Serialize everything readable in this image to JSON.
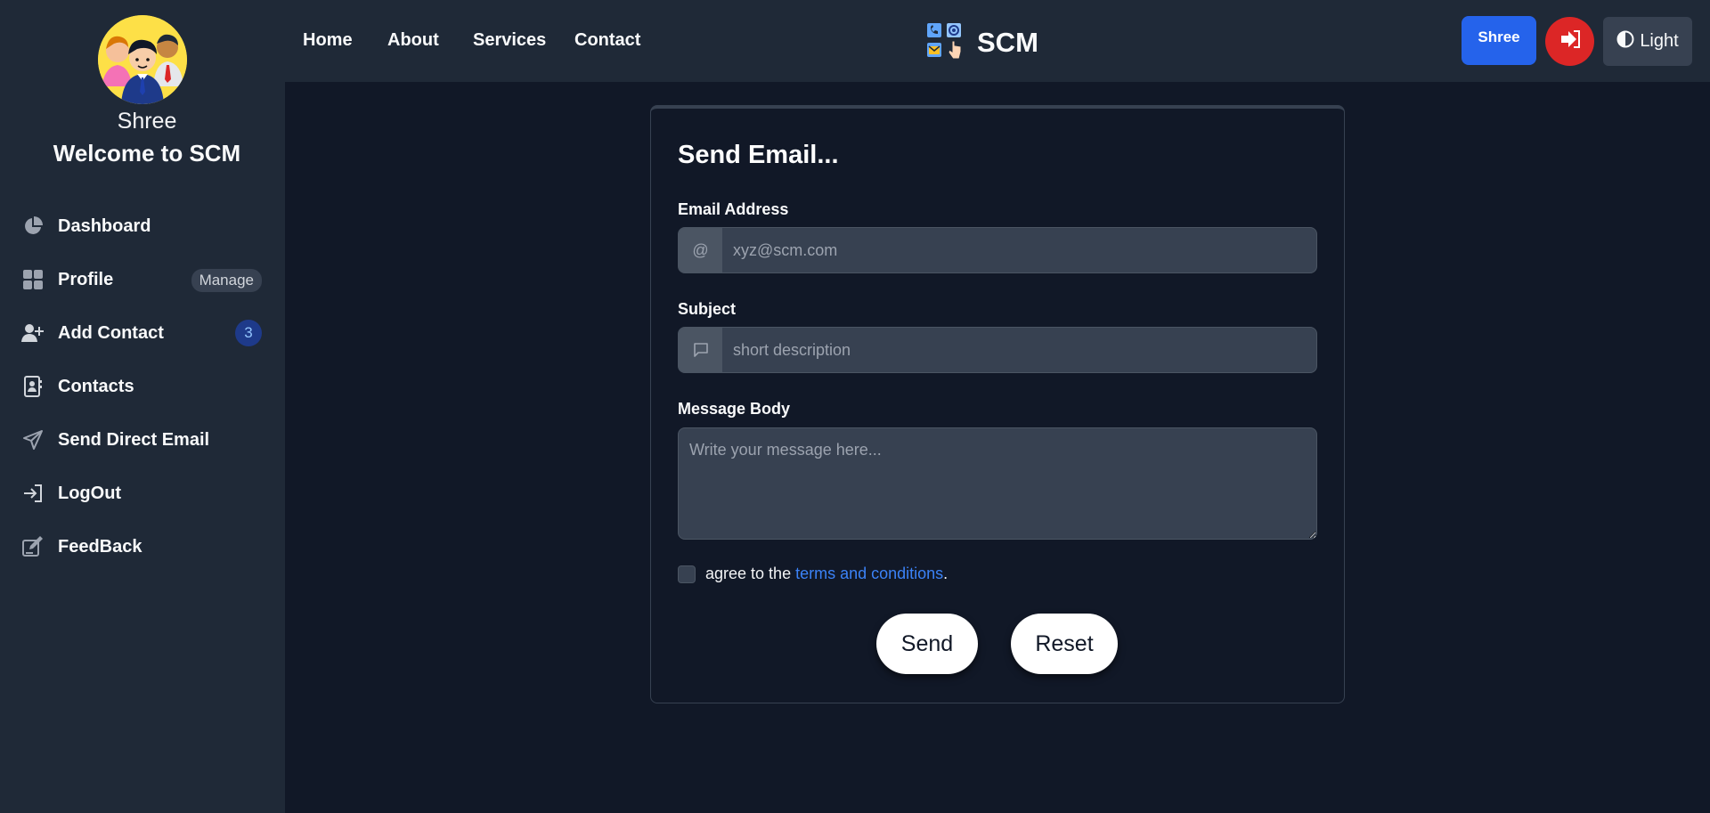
{
  "user": {
    "name": "Shree",
    "welcome": "Welcome to SCM"
  },
  "sidebar": {
    "items": [
      {
        "label": "Dashboard",
        "icon": "pie-chart-icon"
      },
      {
        "label": "Profile",
        "icon": "grid-icon",
        "badge": "Manage"
      },
      {
        "label": "Add Contact",
        "icon": "user-plus-icon",
        "badge": "3"
      },
      {
        "label": "Contacts",
        "icon": "address-book-icon"
      },
      {
        "label": "Send Direct Email",
        "icon": "paper-plane-icon"
      },
      {
        "label": "LogOut",
        "icon": "sign-in-icon"
      },
      {
        "label": "FeedBack",
        "icon": "edit-icon"
      }
    ]
  },
  "navbar": {
    "links": [
      "Home",
      "About",
      "Services",
      "Contact"
    ],
    "brand": "SCM",
    "user_button": "Shree",
    "theme_button": "Light"
  },
  "form": {
    "title": "Send Email...",
    "email_label": "Email Address",
    "email_placeholder": "xyz@scm.com",
    "subject_label": "Subject",
    "subject_placeholder": "short description",
    "message_label": "Message Body",
    "message_placeholder": "Write your message here...",
    "agree_text": "agree to the",
    "terms_link": "terms and conditions",
    "agree_suffix": ".",
    "send_label": "Send",
    "reset_label": "Reset"
  },
  "colors": {
    "page_bg": "#111827",
    "panel_bg": "#1f2937",
    "primary": "#2563eb",
    "danger": "#dc2626",
    "link": "#3b82f6"
  }
}
